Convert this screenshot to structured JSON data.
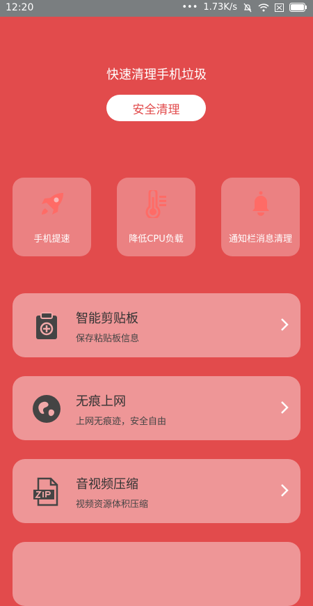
{
  "status_bar": {
    "time": "12:20",
    "dots": "•••",
    "net_speed": "1.73K/s"
  },
  "hero": {
    "headline": "快速清理手机垃圾",
    "button_label": "安全清理"
  },
  "tiles": [
    {
      "label": "手机提速",
      "icon": "rocket-icon"
    },
    {
      "label": "降低CPU负载",
      "icon": "thermometer-icon"
    },
    {
      "label": "通知栏消息清理",
      "icon": "bell-icon"
    }
  ],
  "cards": [
    {
      "title": "智能剪贴板",
      "subtitle": "保存粘贴板信息",
      "icon": "clipboard-add-icon"
    },
    {
      "title": "无痕上网",
      "subtitle": "上网无痕迹，安全自由",
      "icon": "globe-icon"
    },
    {
      "title": "音视频压缩",
      "subtitle": "视频资源体积压缩",
      "icon": "zip-file-icon"
    }
  ],
  "colors": {
    "background": "#e24b4c",
    "tile_icon": "#ff6b66",
    "card_icon": "#444444"
  }
}
